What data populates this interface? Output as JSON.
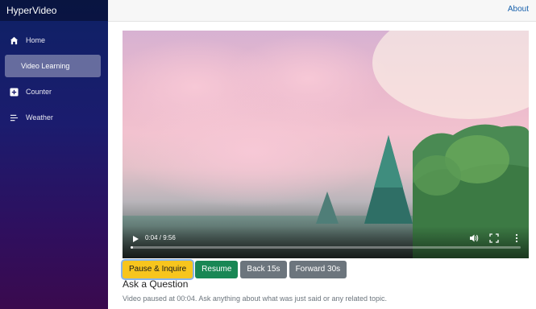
{
  "app": {
    "title": "HyperVideo"
  },
  "sidebar": {
    "items": [
      {
        "label": "Home",
        "icon": "home-icon",
        "active": false
      },
      {
        "label": "Video Learning",
        "icon": "",
        "active": true
      },
      {
        "label": "Counter",
        "icon": "plus-icon",
        "active": false
      },
      {
        "label": "Weather",
        "icon": "list-icon",
        "active": false
      }
    ]
  },
  "topbar": {
    "about_label": "About"
  },
  "video": {
    "time_display": "0:04 / 9:56",
    "progress_fraction": 0.007,
    "controls": [
      "play-icon",
      "volume-icon",
      "fullscreen-icon",
      "more-options-icon"
    ]
  },
  "actions": {
    "pause_inquire": "Pause & Inquire",
    "resume": "Resume",
    "back": "Back 15s",
    "forward": "Forward 30s"
  },
  "question": {
    "title": "Ask a Question",
    "status": "Video paused at 00:04. Ask anything about what was just said or any related topic."
  },
  "colors": {
    "accent_link": "#1861ac",
    "warning": "#f7c51e",
    "success": "#198754",
    "secondary": "#6c757d"
  }
}
